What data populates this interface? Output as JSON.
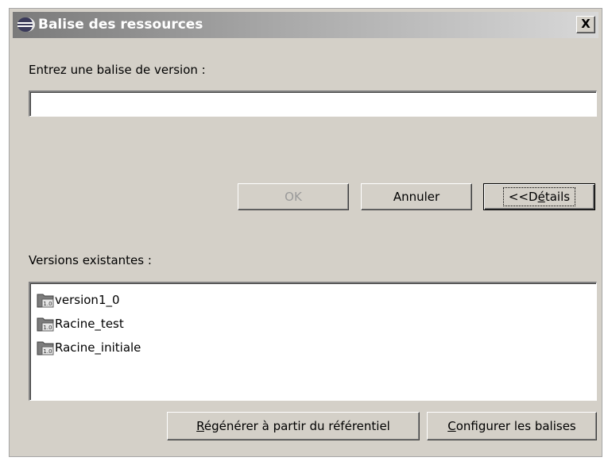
{
  "window": {
    "title": "Balise des ressources",
    "close_label": "X"
  },
  "form": {
    "tag_label": "Entrez une balise de version :",
    "tag_value": ""
  },
  "buttons": {
    "ok": "OK",
    "cancel": "Annuler",
    "details_prefix": "<<D",
    "details_mnemonic": "é",
    "details_suffix": "tails",
    "regenerate_mnemonic": "R",
    "regenerate_suffix": "égénérer à partir du référentiel",
    "configure_mnemonic": "C",
    "configure_suffix": "onfigurer les balises"
  },
  "versions": {
    "label": "Versions existantes :",
    "items": [
      {
        "name": "version1_0",
        "icon": "version-tag-icon",
        "badge": "1.0"
      },
      {
        "name": "Racine_test",
        "icon": "version-tag-icon",
        "badge": "1.0"
      },
      {
        "name": "Racine_initiale",
        "icon": "version-tag-icon",
        "badge": "1.0"
      }
    ]
  },
  "colors": {
    "dialog_background": "#d4d0c8",
    "title_gradient_start": "#7a7a7a",
    "title_gradient_end": "#d8d8d8",
    "disabled_text": "#9a9a9a"
  }
}
